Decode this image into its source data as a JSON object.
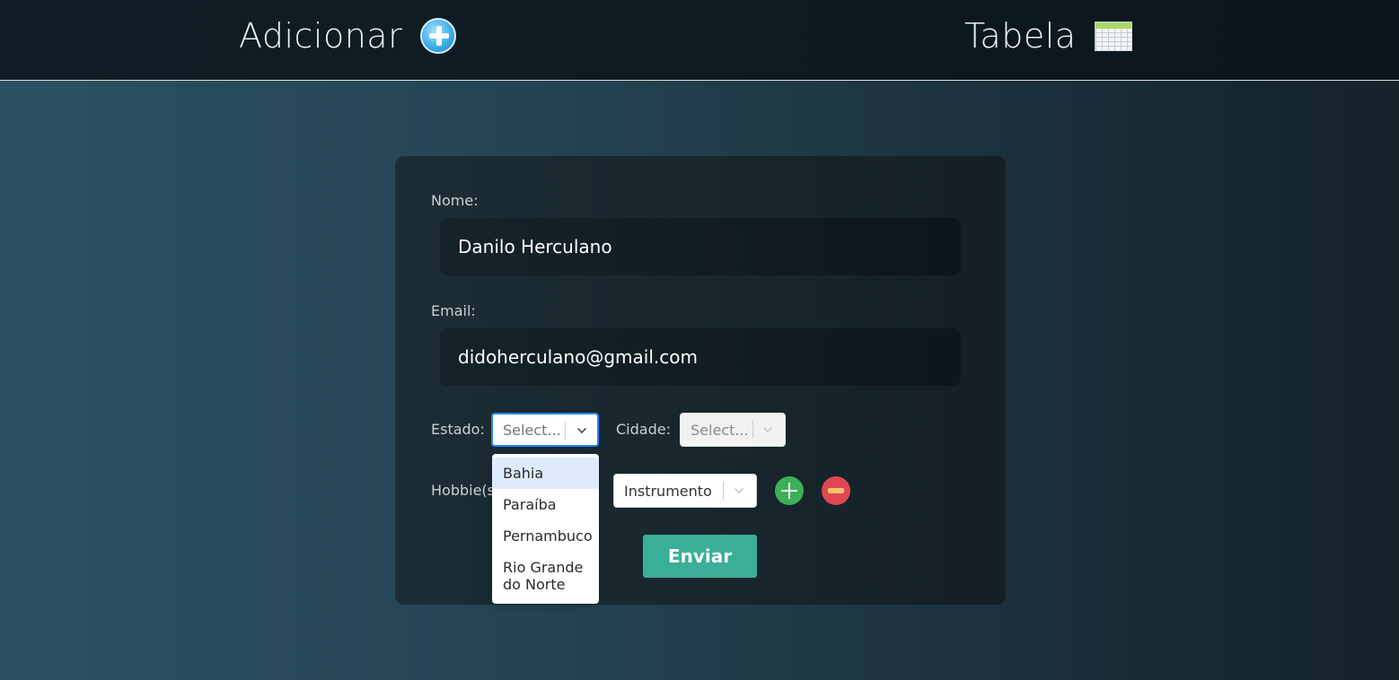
{
  "nav": {
    "add_label": "Adicionar",
    "table_label": "Tabela"
  },
  "form": {
    "nome_label": "Nome:",
    "nome_value": "Danilo Herculano",
    "email_label": "Email:",
    "email_value": "didoherculano@gmail.com",
    "estado_label": "Estado:",
    "estado_placeholder": "Select...",
    "cidade_label": "Cidade:",
    "cidade_placeholder": "Select...",
    "hobbies_label": "Hobbie(s):",
    "hobby_value": "Instrumento",
    "submit_label": "Enviar"
  },
  "estado_options": [
    "Bahia",
    "Paraíba",
    "Pernambuco",
    "Rio Grande do Norte"
  ],
  "colors": {
    "accent": "#3aae96",
    "focus": "#2684ff",
    "add": "#3cb058",
    "remove": "#e04754"
  }
}
